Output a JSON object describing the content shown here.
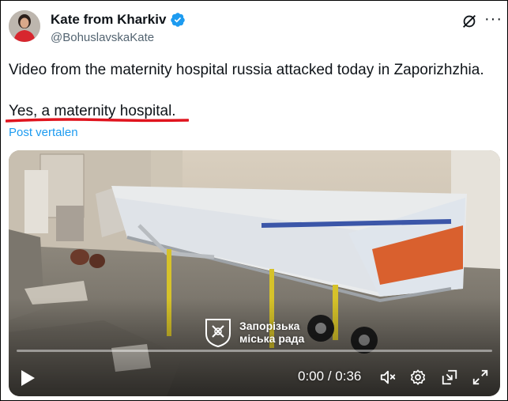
{
  "author": {
    "name": "Kate from Kharkiv",
    "handle": "@BohuslavskaKate",
    "verified": true
  },
  "tweet": {
    "line1": "Video from the maternity hospital russia attacked today in Zaporizhzhia.",
    "line2": "Yes, a maternity hospital.",
    "translate_label": "Post vertalen"
  },
  "video": {
    "watermark_line1": "Запорізька",
    "watermark_line2": "міська рада",
    "time_current": "0:00",
    "time_separator": "/",
    "time_total": "0:36",
    "progress": 0
  },
  "colors": {
    "accent": "#1d9bf0",
    "underline": "#e0141e",
    "text": "#0f1419",
    "muted": "#536471"
  },
  "icons": {
    "verified": "verified-badge-icon",
    "grok": "grok-icon",
    "more": "more-icon",
    "play": "play-icon",
    "volume": "volume-muted-icon",
    "settings": "settings-gear-icon",
    "pip": "picture-in-picture-icon",
    "fullscreen": "fullscreen-icon"
  }
}
